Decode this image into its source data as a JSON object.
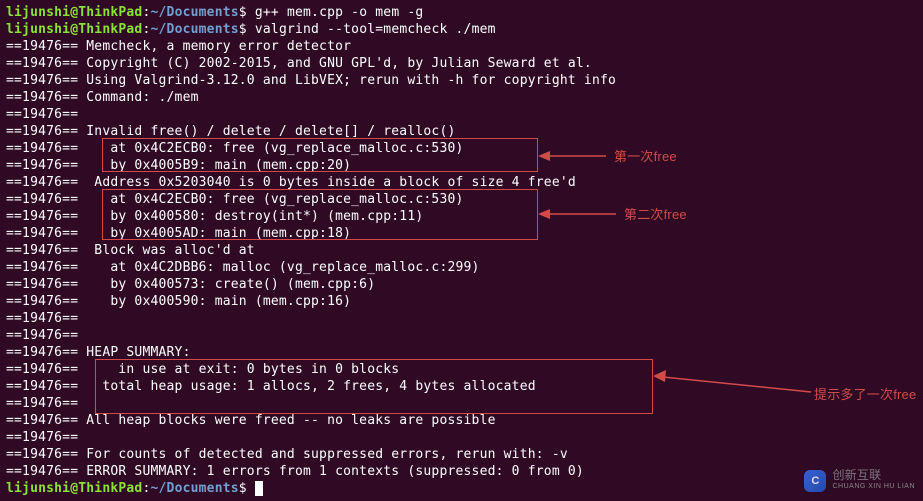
{
  "prompt": {
    "user": "lijunshi@ThinkPad",
    "sep": ":",
    "path": "~/Documents",
    "sym": "$ "
  },
  "cmds": {
    "c1": "g++ mem.cpp -o mem -g",
    "c2": "valgrind --tool=memcheck ./mem"
  },
  "out": {
    "l01": "==19476== Memcheck, a memory error detector",
    "l02": "==19476== Copyright (C) 2002-2015, and GNU GPL'd, by Julian Seward et al.",
    "l03": "==19476== Using Valgrind-3.12.0 and LibVEX; rerun with -h for copyright info",
    "l04": "==19476== Command: ./mem",
    "l05": "==19476== ",
    "l06": "==19476== Invalid free() / delete / delete[] / realloc()",
    "l07": "==19476==    at 0x4C2ECB0: free (vg_replace_malloc.c:530)",
    "l08": "==19476==    by 0x4005B9: main (mem.cpp:20)",
    "l09": "==19476==  Address 0x5203040 is 0 bytes inside a block of size 4 free'd",
    "l10": "==19476==    at 0x4C2ECB0: free (vg_replace_malloc.c:530)",
    "l11": "==19476==    by 0x400580: destroy(int*) (mem.cpp:11)",
    "l12": "==19476==    by 0x4005AD: main (mem.cpp:18)",
    "l13": "==19476==  Block was alloc'd at",
    "l14": "==19476==    at 0x4C2DBB6: malloc (vg_replace_malloc.c:299)",
    "l15": "==19476==    by 0x400573: create() (mem.cpp:6)",
    "l16": "==19476==    by 0x400590: main (mem.cpp:16)",
    "l17": "==19476== ",
    "l18": "==19476== ",
    "l19": "==19476== HEAP SUMMARY:",
    "l20": "==19476==     in use at exit: 0 bytes in 0 blocks",
    "l21": "==19476==   total heap usage: 1 allocs, 2 frees, 4 bytes allocated",
    "l22": "==19476== ",
    "l23": "==19476== All heap blocks were freed -- no leaks are possible",
    "l24": "==19476== ",
    "l25": "==19476== For counts of detected and suppressed errors, rerun with: -v",
    "l26": "==19476== ERROR SUMMARY: 1 errors from 1 contexts (suppressed: 0 from 0)"
  },
  "annot": {
    "a1": "第一次free",
    "a2": "第二次free",
    "a3": "提示多了一次free"
  },
  "wm_text": "创新互联",
  "wm_sub": "CHUANG XIN HU LIAN"
}
